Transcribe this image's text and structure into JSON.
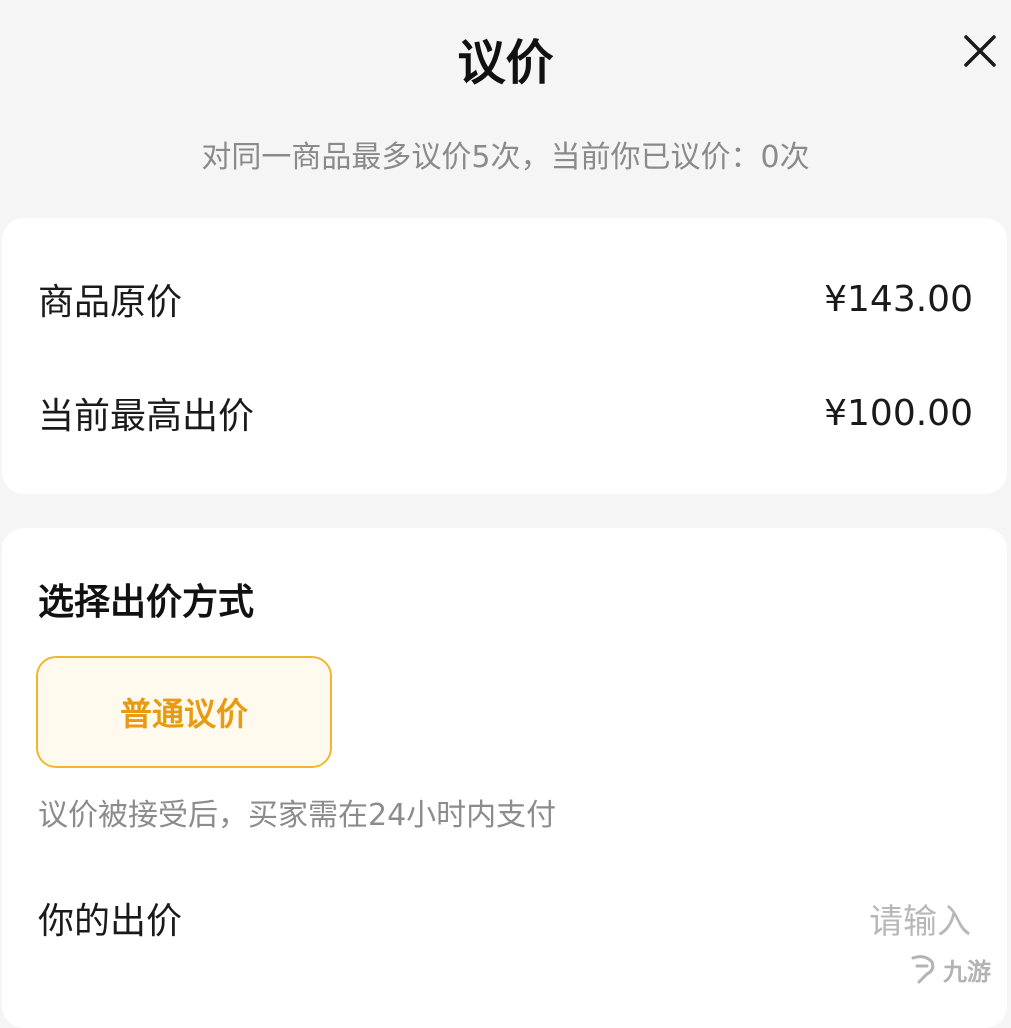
{
  "header": {
    "title": "议价",
    "subtitle": "对同一商品最多议价5次，当前你已议价：0次"
  },
  "price_card": {
    "original_price_label": "商品原价",
    "original_price_value": "¥143.00",
    "highest_bid_label": "当前最高出价",
    "highest_bid_value": "¥100.00"
  },
  "method_card": {
    "section_title": "选择出价方式",
    "option_label": "普通议价",
    "hint": "议价被接受后，买家需在24小时内支付",
    "bid_label": "你的出价",
    "bid_placeholder": "请输入",
    "bid_value": ""
  },
  "watermark": {
    "text": "九游"
  },
  "colors": {
    "accent": "#e89b12",
    "accent_border": "#f2b731",
    "accent_bg": "#fff9ee",
    "muted_text": "#8a8a8a",
    "page_bg": "#f5f5f5"
  },
  "icons": {
    "close": "close-icon",
    "watermark_logo": "logo-icon"
  }
}
